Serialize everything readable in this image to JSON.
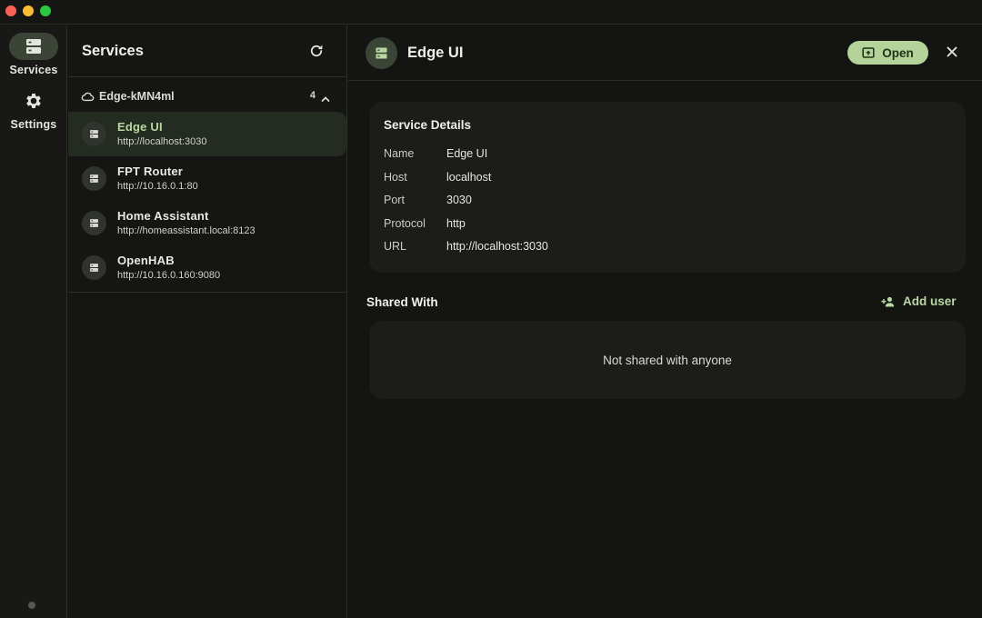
{
  "window": {
    "traffic_lights": {
      "close": "#fe5f57",
      "minimize": "#febc2e",
      "maximize": "#28c840"
    }
  },
  "nav": {
    "items": [
      {
        "label": "Services",
        "icon": "server-icon",
        "active": true
      },
      {
        "label": "Settings",
        "icon": "gear-icon",
        "active": false
      }
    ]
  },
  "services_panel": {
    "title": "Services",
    "refresh_icon": "refresh-icon",
    "group": {
      "name": "Edge-kMN4ml",
      "count": "4",
      "icon": "cloud-icon",
      "expanded": true
    },
    "services": [
      {
        "name": "Edge UI",
        "url": "http://localhost:3030",
        "selected": true
      },
      {
        "name": "FPT Router",
        "url": "http://10.16.0.1:80",
        "selected": false
      },
      {
        "name": "Home Assistant",
        "url": "http://homeassistant.local:8123",
        "selected": false
      },
      {
        "name": "OpenHAB",
        "url": "http://10.16.0.160:9080",
        "selected": false
      }
    ]
  },
  "detail": {
    "title": "Edge UI",
    "open_label": "Open",
    "service_details": {
      "title": "Service Details",
      "rows": [
        {
          "key": "Name",
          "value": "Edge UI"
        },
        {
          "key": "Host",
          "value": "localhost"
        },
        {
          "key": "Port",
          "value": "3030"
        },
        {
          "key": "Protocol",
          "value": "http"
        },
        {
          "key": "URL",
          "value": "http://localhost:3030"
        }
      ]
    },
    "shared_with": {
      "title": "Shared With",
      "add_user_label": "Add user",
      "empty_message": "Not shared with anyone"
    }
  },
  "colors": {
    "accent": "#b3d39b",
    "accent_text": "#b9d6a1",
    "background": "#141513",
    "card": "#1c1d1b",
    "selected_row": "#242b21"
  }
}
